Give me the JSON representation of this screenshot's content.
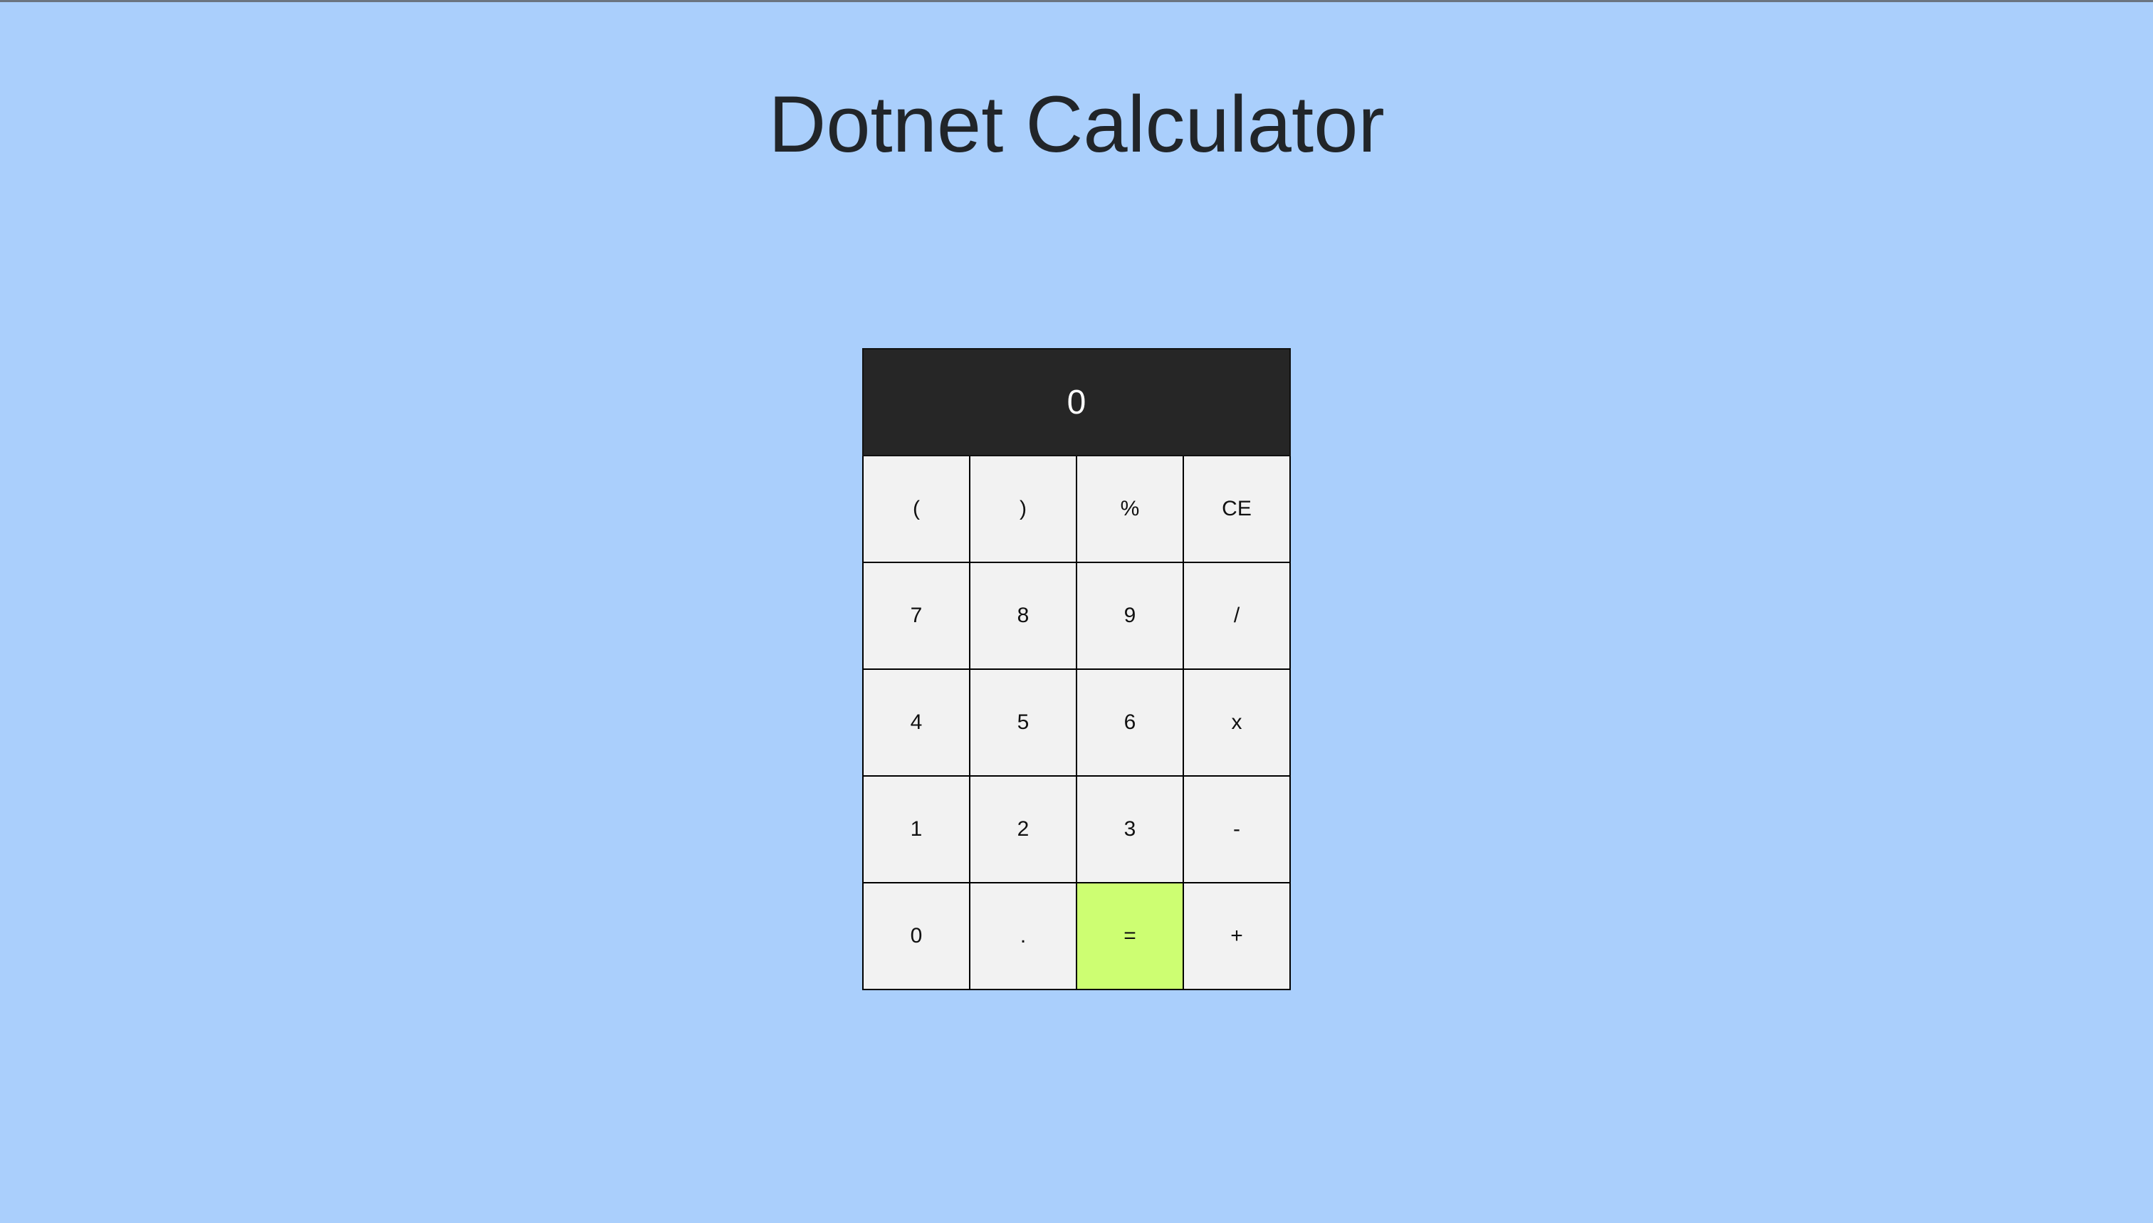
{
  "page": {
    "title": "Dotnet Calculator"
  },
  "calculator": {
    "display_value": "0",
    "keys": [
      {
        "label": "(",
        "name": "key-open-paren"
      },
      {
        "label": ")",
        "name": "key-close-paren"
      },
      {
        "label": "%",
        "name": "key-percent"
      },
      {
        "label": "CE",
        "name": "key-clear-entry"
      },
      {
        "label": "7",
        "name": "key-7"
      },
      {
        "label": "8",
        "name": "key-8"
      },
      {
        "label": "9",
        "name": "key-9"
      },
      {
        "label": "/",
        "name": "key-divide"
      },
      {
        "label": "4",
        "name": "key-4"
      },
      {
        "label": "5",
        "name": "key-5"
      },
      {
        "label": "6",
        "name": "key-6"
      },
      {
        "label": "x",
        "name": "key-multiply"
      },
      {
        "label": "1",
        "name": "key-1"
      },
      {
        "label": "2",
        "name": "key-2"
      },
      {
        "label": "3",
        "name": "key-3"
      },
      {
        "label": "-",
        "name": "key-subtract"
      },
      {
        "label": "0",
        "name": "key-0"
      },
      {
        "label": ".",
        "name": "key-decimal"
      },
      {
        "label": "=",
        "name": "key-equals",
        "accent": true
      },
      {
        "label": "+",
        "name": "key-add"
      }
    ]
  },
  "colors": {
    "background": "#aacffc",
    "display_background": "#262626",
    "key_background": "#f2f2f2",
    "equals_accent": "#cdfe72",
    "title_text": "#212529"
  }
}
